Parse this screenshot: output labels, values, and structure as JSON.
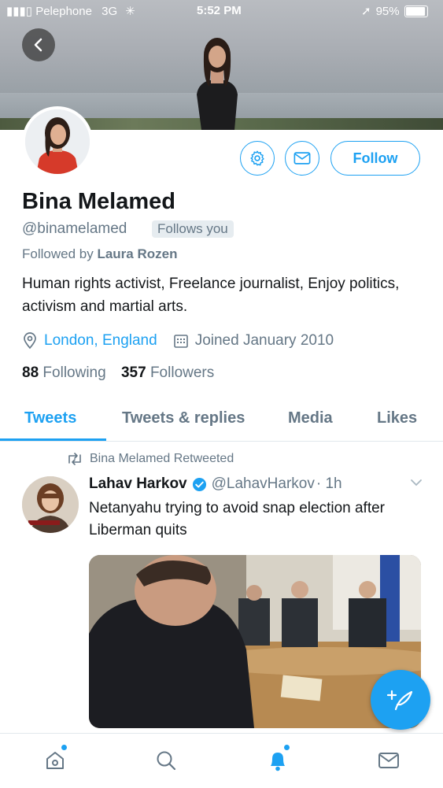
{
  "status_bar": {
    "carrier": "Pelephone",
    "network": "3G",
    "time": "5:52 PM",
    "battery": "95%"
  },
  "profile": {
    "name": "Bina Melamed",
    "handle": "@binamelamed",
    "follows_you": "Follows you",
    "followed_by_prefix": "Followed by",
    "followed_by_name": "Laura Rozen",
    "bio": "Human rights activist, Freelance journalist, Enjoy politics, activism and martial arts.",
    "location": "London, England",
    "joined": "Joined January 2010",
    "following_count": "88",
    "following_label": "Following",
    "followers_count": "357",
    "followers_label": "Followers"
  },
  "buttons": {
    "follow": "Follow"
  },
  "tabs": [
    {
      "label": "Tweets",
      "active": true
    },
    {
      "label": "Tweets & replies"
    },
    {
      "label": "Media"
    },
    {
      "label": "Likes"
    }
  ],
  "tweet": {
    "retweet_label": "Bina Melamed Retweeted",
    "author_name": "Lahav Harkov",
    "author_handle": "@LahavHarkov",
    "time": "· 1h",
    "text": "Netanyahu trying to avoid snap election after Liberman quits",
    "verified": true
  },
  "icons": {
    "back": "back-arrow-icon",
    "settings": "gear-icon",
    "message": "envelope-icon",
    "location": "location-pin-icon",
    "calendar": "calendar-icon",
    "retweet": "retweet-icon",
    "verified": "verified-badge-icon",
    "caret": "chevron-down-icon",
    "compose": "compose-tweet-icon",
    "home": "home-icon",
    "search": "search-icon",
    "notifications": "bell-icon",
    "messages": "envelope-icon"
  },
  "colors": {
    "accent": "#1da1f2",
    "text": "#14171a",
    "muted": "#657786"
  }
}
